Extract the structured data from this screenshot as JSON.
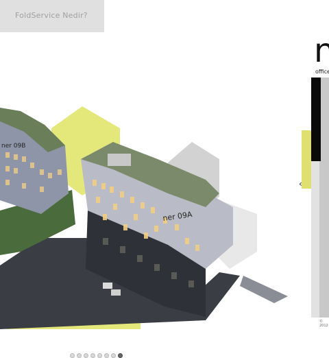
{
  "header": {
    "menu_label": "FoldService Nedir?"
  },
  "hero": {
    "building_sign_left": "ner 09B",
    "building_sign_right": "ner 09A",
    "accent_color": "#dfe06f",
    "slider_dots_count": 8,
    "slider_active_index": 7
  },
  "brand": {
    "logo_letter": "n",
    "tagline": "office",
    "copyright": "© 2012"
  },
  "nav": {
    "prev_icon": "chevron-left-icon"
  }
}
